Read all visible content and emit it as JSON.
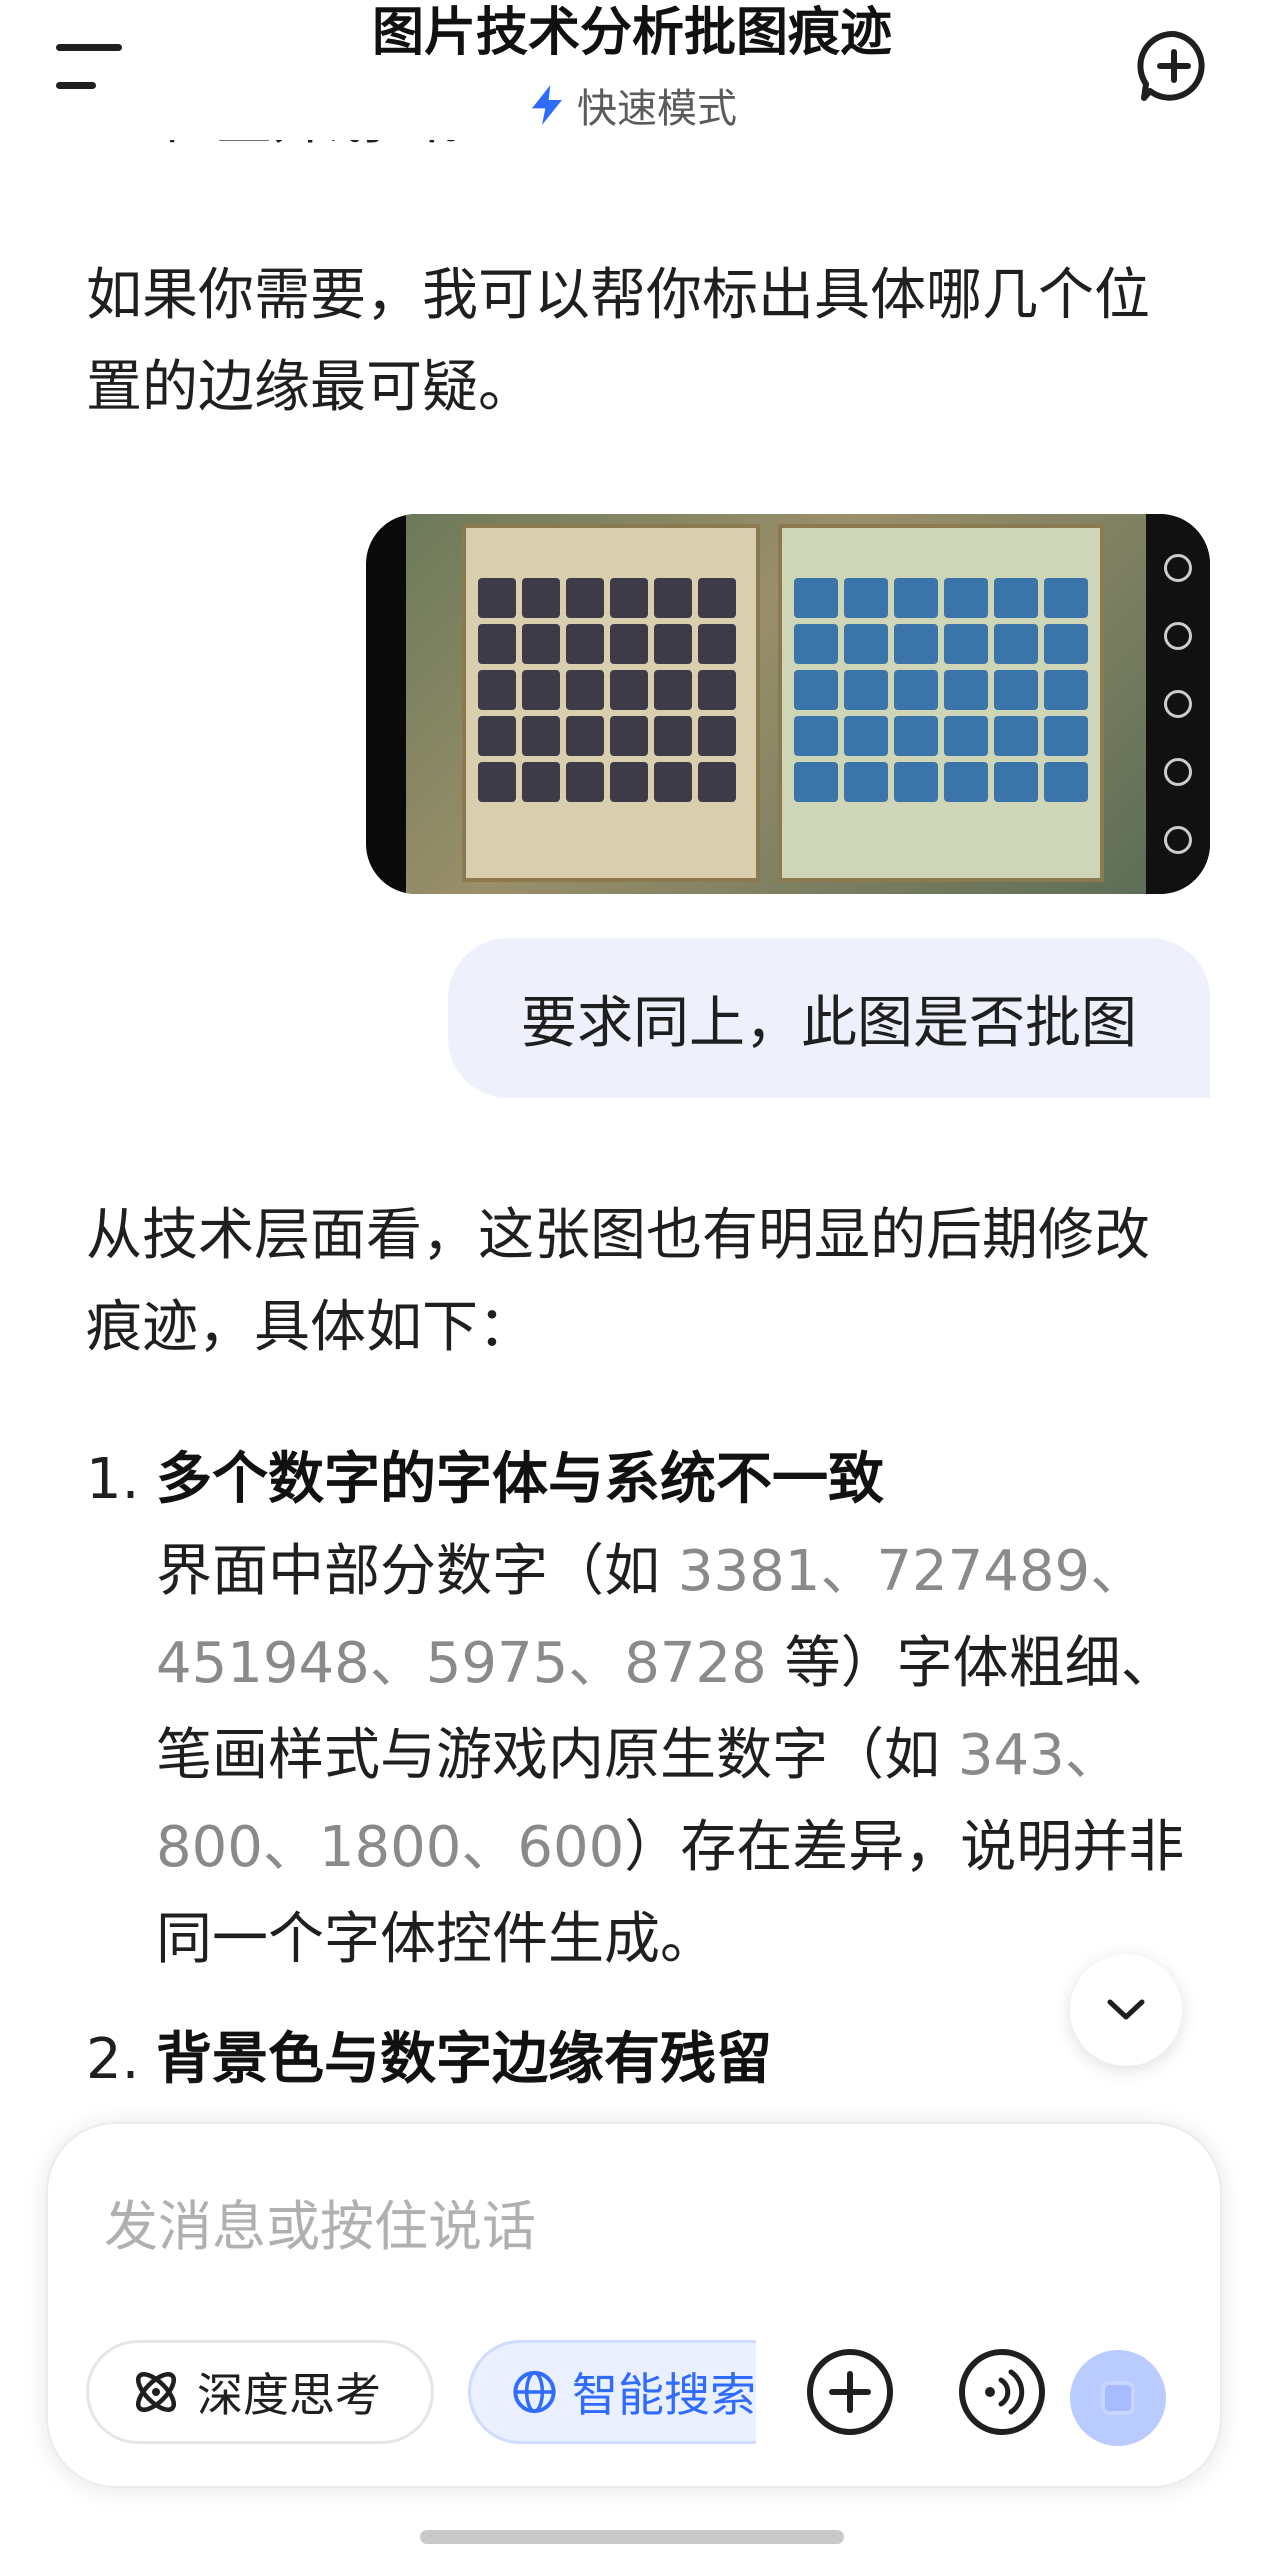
{
  "header": {
    "title": "图片技术分析批图痕迹",
    "mode_label": "快速模式"
  },
  "messages": {
    "prev_cut_line": "位置并划出。",
    "prev_paragraph": "如果你需要，我可以帮你标出具体哪几个位置的边缘最可疑。",
    "user_text": "要求同上，此图是否批图",
    "reply_intro": "从技术层面看，这张图也有明显的后期修改痕迹，具体如下：",
    "items": [
      {
        "num": "1.",
        "heading": "多个数字的字体与系统不一致",
        "body": {
          "p1": "界面中部分数字（如 ",
          "n1": "3381",
          "s1": "、",
          "n2": "727489",
          "s2": "、",
          "n3": "451948",
          "s3": "、",
          "n4": "5975",
          "s4": "、",
          "n5": "8728",
          "p2": " 等）字体粗细、笔画样式与游戏内原生数字（如 ",
          "n6": "343",
          "s5": "、",
          "n7": "800",
          "s6": "、",
          "n8": "1800",
          "s7": "、",
          "n9": "600",
          "p3": "）存在差异，说明并非同一个字体控件生成。"
        }
      },
      {
        "num": "2.",
        "heading": "背景色与数字边缘有残留"
      }
    ]
  },
  "composer": {
    "placeholder": "发消息或按住说话",
    "deep_think_label": "深度思考",
    "smart_search_label": "智能搜索"
  },
  "colors": {
    "accent": "#2f6bff",
    "user_bubble": "#eef1fb",
    "number_highlight": "#8a8a8a"
  },
  "icons": {
    "menu": "menu-icon",
    "new_chat": "new-chat-icon",
    "lightning": "lightning-icon",
    "chevron_down": "chevron-down-icon",
    "deep_think": "atom-icon",
    "search": "globe-icon",
    "add": "plus-circle-icon",
    "voice": "voice-icon",
    "send": "send-icon"
  }
}
